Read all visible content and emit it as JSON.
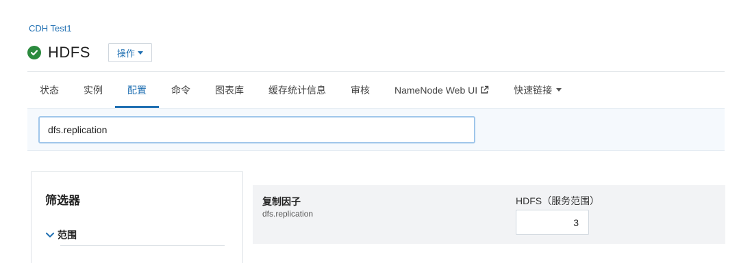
{
  "header": {
    "cluster_link": "CDH Test1",
    "service_title": "HDFS",
    "actions_label": "操作"
  },
  "tabs": [
    {
      "label": "状态",
      "active": false
    },
    {
      "label": "实例",
      "active": false
    },
    {
      "label": "配置",
      "active": true
    },
    {
      "label": "命令",
      "active": false
    },
    {
      "label": "图表库",
      "active": false
    },
    {
      "label": "缓存统计信息",
      "active": false
    },
    {
      "label": "审核",
      "active": false
    },
    {
      "label": "NameNode Web UI",
      "active": false,
      "icon": "external-link-icon"
    },
    {
      "label": "快速链接",
      "active": false,
      "icon": "caret-down-icon"
    }
  ],
  "search": {
    "value": "dfs.replication"
  },
  "filters": {
    "title": "筛选器",
    "groups": [
      {
        "label": "范围",
        "expanded": true
      }
    ]
  },
  "config_row": {
    "display_name": "复制因子",
    "property_key": "dfs.replication",
    "scope_label": "HDFS（服务范围）",
    "value": "3"
  },
  "colors": {
    "accent": "#1f6fb2",
    "status_ok": "#2b8a3e",
    "search_band_bg": "#f5f9fd",
    "row_bg": "#f2f3f5"
  }
}
